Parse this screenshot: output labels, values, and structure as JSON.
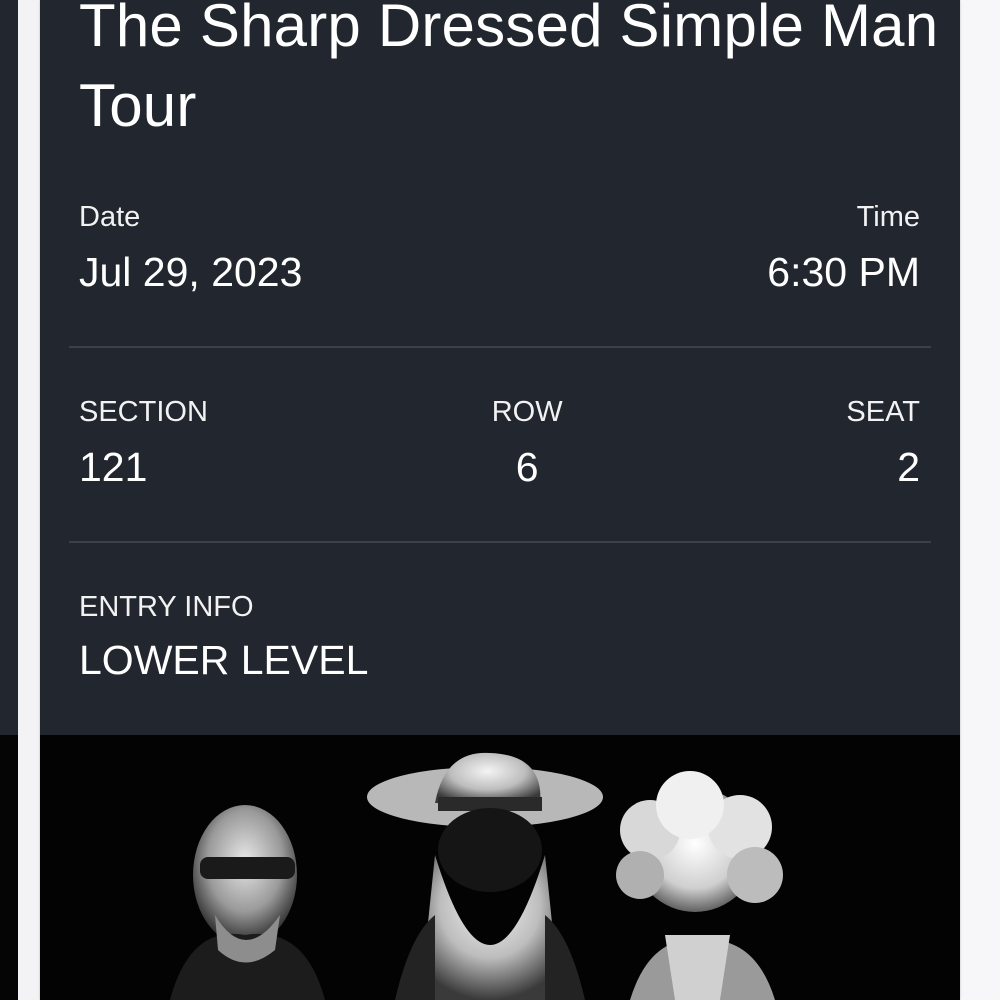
{
  "event": {
    "title": "The Sharp Dressed Simple Man Tour"
  },
  "schedule": {
    "date_label": "Date",
    "date_value": "Jul 29, 2023",
    "time_label": "Time",
    "time_value": "6:30 PM"
  },
  "seating": {
    "section_label": "SECTION",
    "section_value": "121",
    "row_label": "ROW",
    "row_value": "6",
    "seat_label": "SEAT",
    "seat_value": "2"
  },
  "entry": {
    "label": "ENTRY INFO",
    "value": "LOWER LEVEL"
  },
  "colors": {
    "card_background": "#22262e",
    "divider": "#3b4049",
    "text": "#ffffff",
    "photo_background": "#030303"
  }
}
